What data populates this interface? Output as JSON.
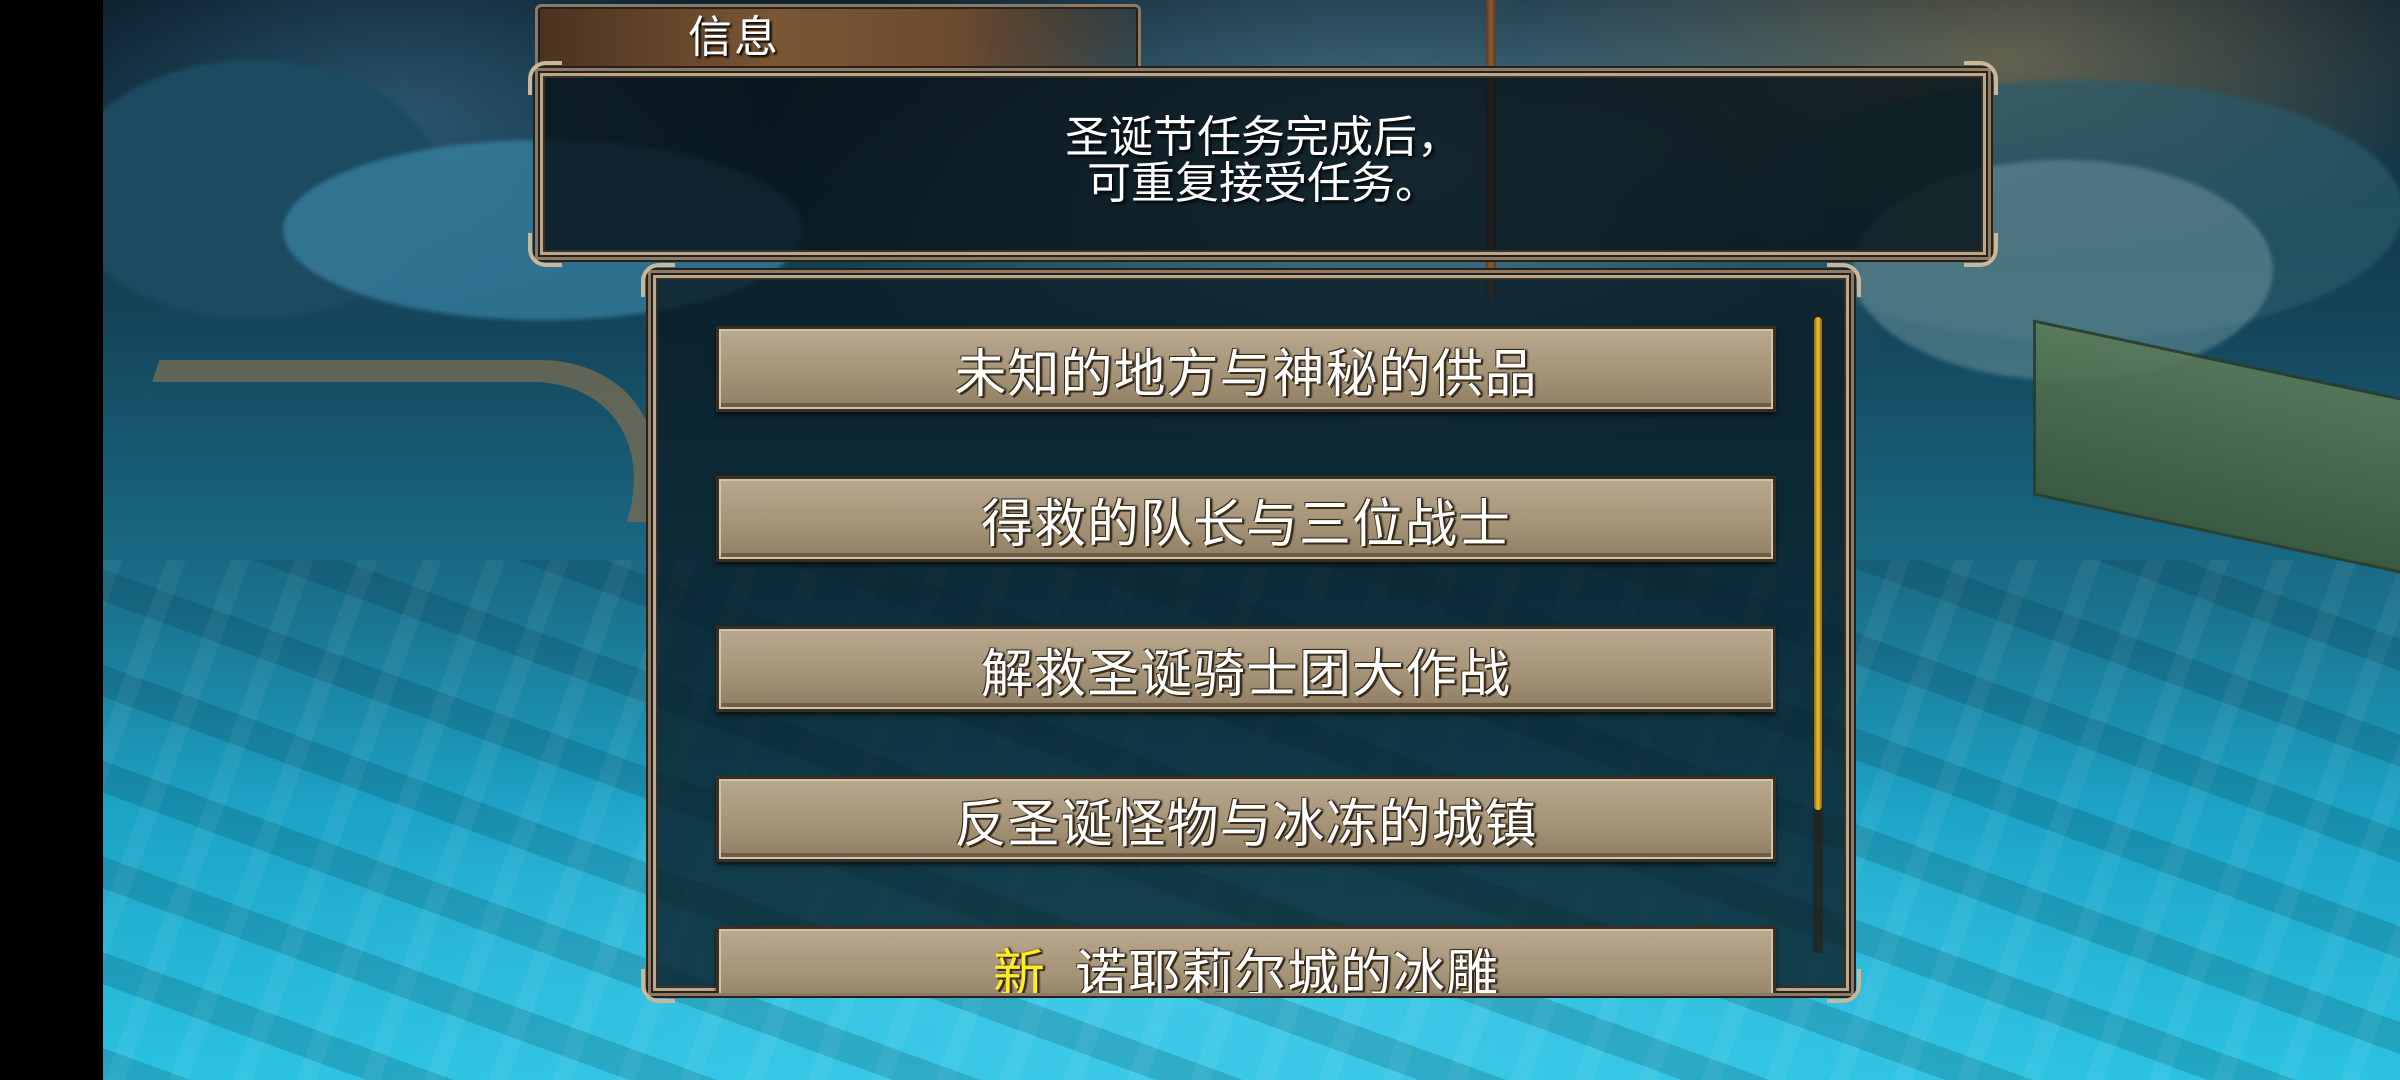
{
  "dialog": {
    "tab_title": "信息",
    "message": "圣诞节任务完成后，\n可重复接受任务。"
  },
  "quests": [
    {
      "label": "未知的地方与神秘的供品",
      "is_new": false
    },
    {
      "label": "得救的队长与三位战士",
      "is_new": false
    },
    {
      "label": "解救圣诞骑士团大作战",
      "is_new": false
    },
    {
      "label": "反圣诞怪物与冰冻的城镇",
      "is_new": false
    },
    {
      "label": "诺耶莉尔城的冰雕",
      "is_new": true,
      "badge": "新"
    }
  ],
  "colors": {
    "button_face": "#a69478",
    "frame": "#8a7a68",
    "new_badge": "#ffee22",
    "scroll_thumb": "#f0c030"
  },
  "scroll": {
    "visible_fraction": 0.78
  }
}
